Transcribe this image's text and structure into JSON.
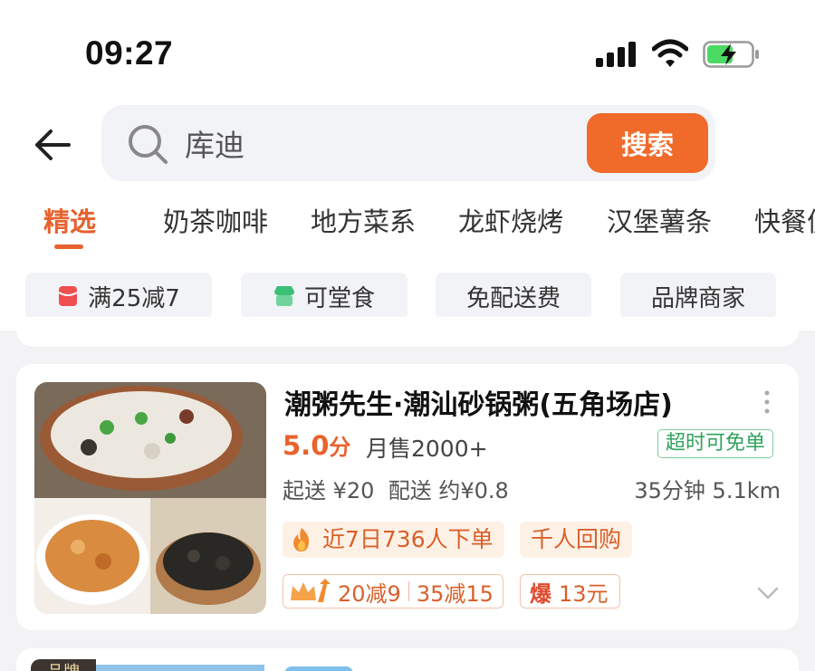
{
  "status_bar": {
    "time": "09:27"
  },
  "search": {
    "value": "库迪",
    "button_label": "搜索"
  },
  "tabs": [
    {
      "label": "精选",
      "active": true
    },
    {
      "label": "奶茶咖啡"
    },
    {
      "label": "地方菜系"
    },
    {
      "label": "龙虾烧烤"
    },
    {
      "label": "汉堡薯条"
    },
    {
      "label": "快餐便"
    }
  ],
  "filters": [
    {
      "label": "满25减7",
      "icon": "red-envelope-icon",
      "color": "#ef4f4f"
    },
    {
      "label": "可堂食",
      "icon": "shop-icon",
      "color": "#3cbf77"
    },
    {
      "label": "免配送费"
    },
    {
      "label": "品牌商家"
    }
  ],
  "store": {
    "name": "潮粥先生·潮汕砂锅粥(五角场店)",
    "score": "5.0",
    "score_unit": "分",
    "monthly_sales": "月售2000+",
    "badge": "超时可免单",
    "min_order": "起送 ¥20",
    "delivery_fee": "配送 约¥0.8",
    "eta": "35分钟",
    "distance": "5.1km",
    "tag_hot": "近7日736人下单",
    "tag_repeat": "千人回购",
    "promos": [
      "20减9",
      "35减15"
    ],
    "boom_label": "爆",
    "boom_value": "13元"
  },
  "next_store": {
    "badge": "品牌"
  },
  "colors": {
    "accent": "#f06a2a",
    "green": "#2fa35b",
    "background": "#f3f3f5"
  }
}
